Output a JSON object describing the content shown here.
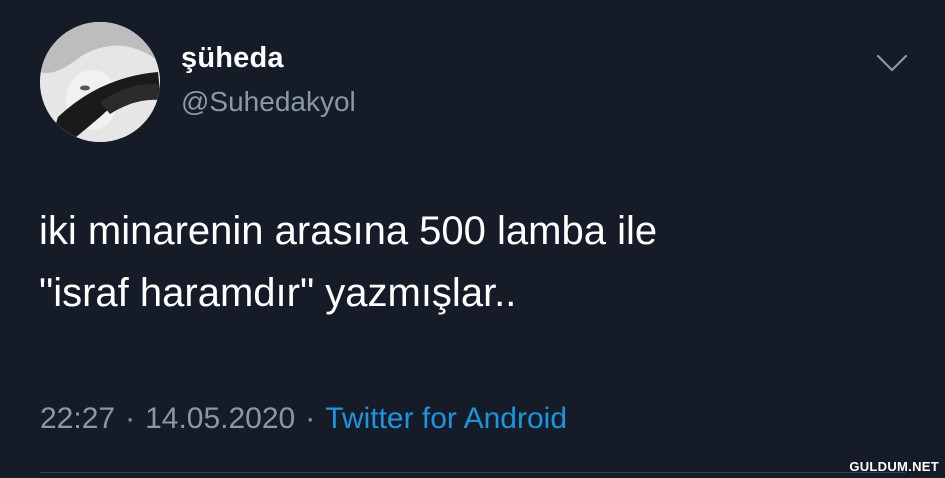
{
  "user": {
    "display_name": "şüheda",
    "handle": "@Suhedakyol",
    "avatar_icon": "profile-avatar"
  },
  "tweet": {
    "lines": [
      "iki minarenin arasına 500 lamba ile",
      "\"israf haramdır\" yazmışlar.."
    ],
    "time": "22:27",
    "separator": "·",
    "date": "14.05.2020",
    "source": "Twitter for Android"
  },
  "menu_icon": "chevron-down-icon",
  "watermark": "GULDUM.NET",
  "colors": {
    "background": "#151c28",
    "text": "#ffffff",
    "secondary": "#8899a6",
    "link": "#1b95e0"
  }
}
